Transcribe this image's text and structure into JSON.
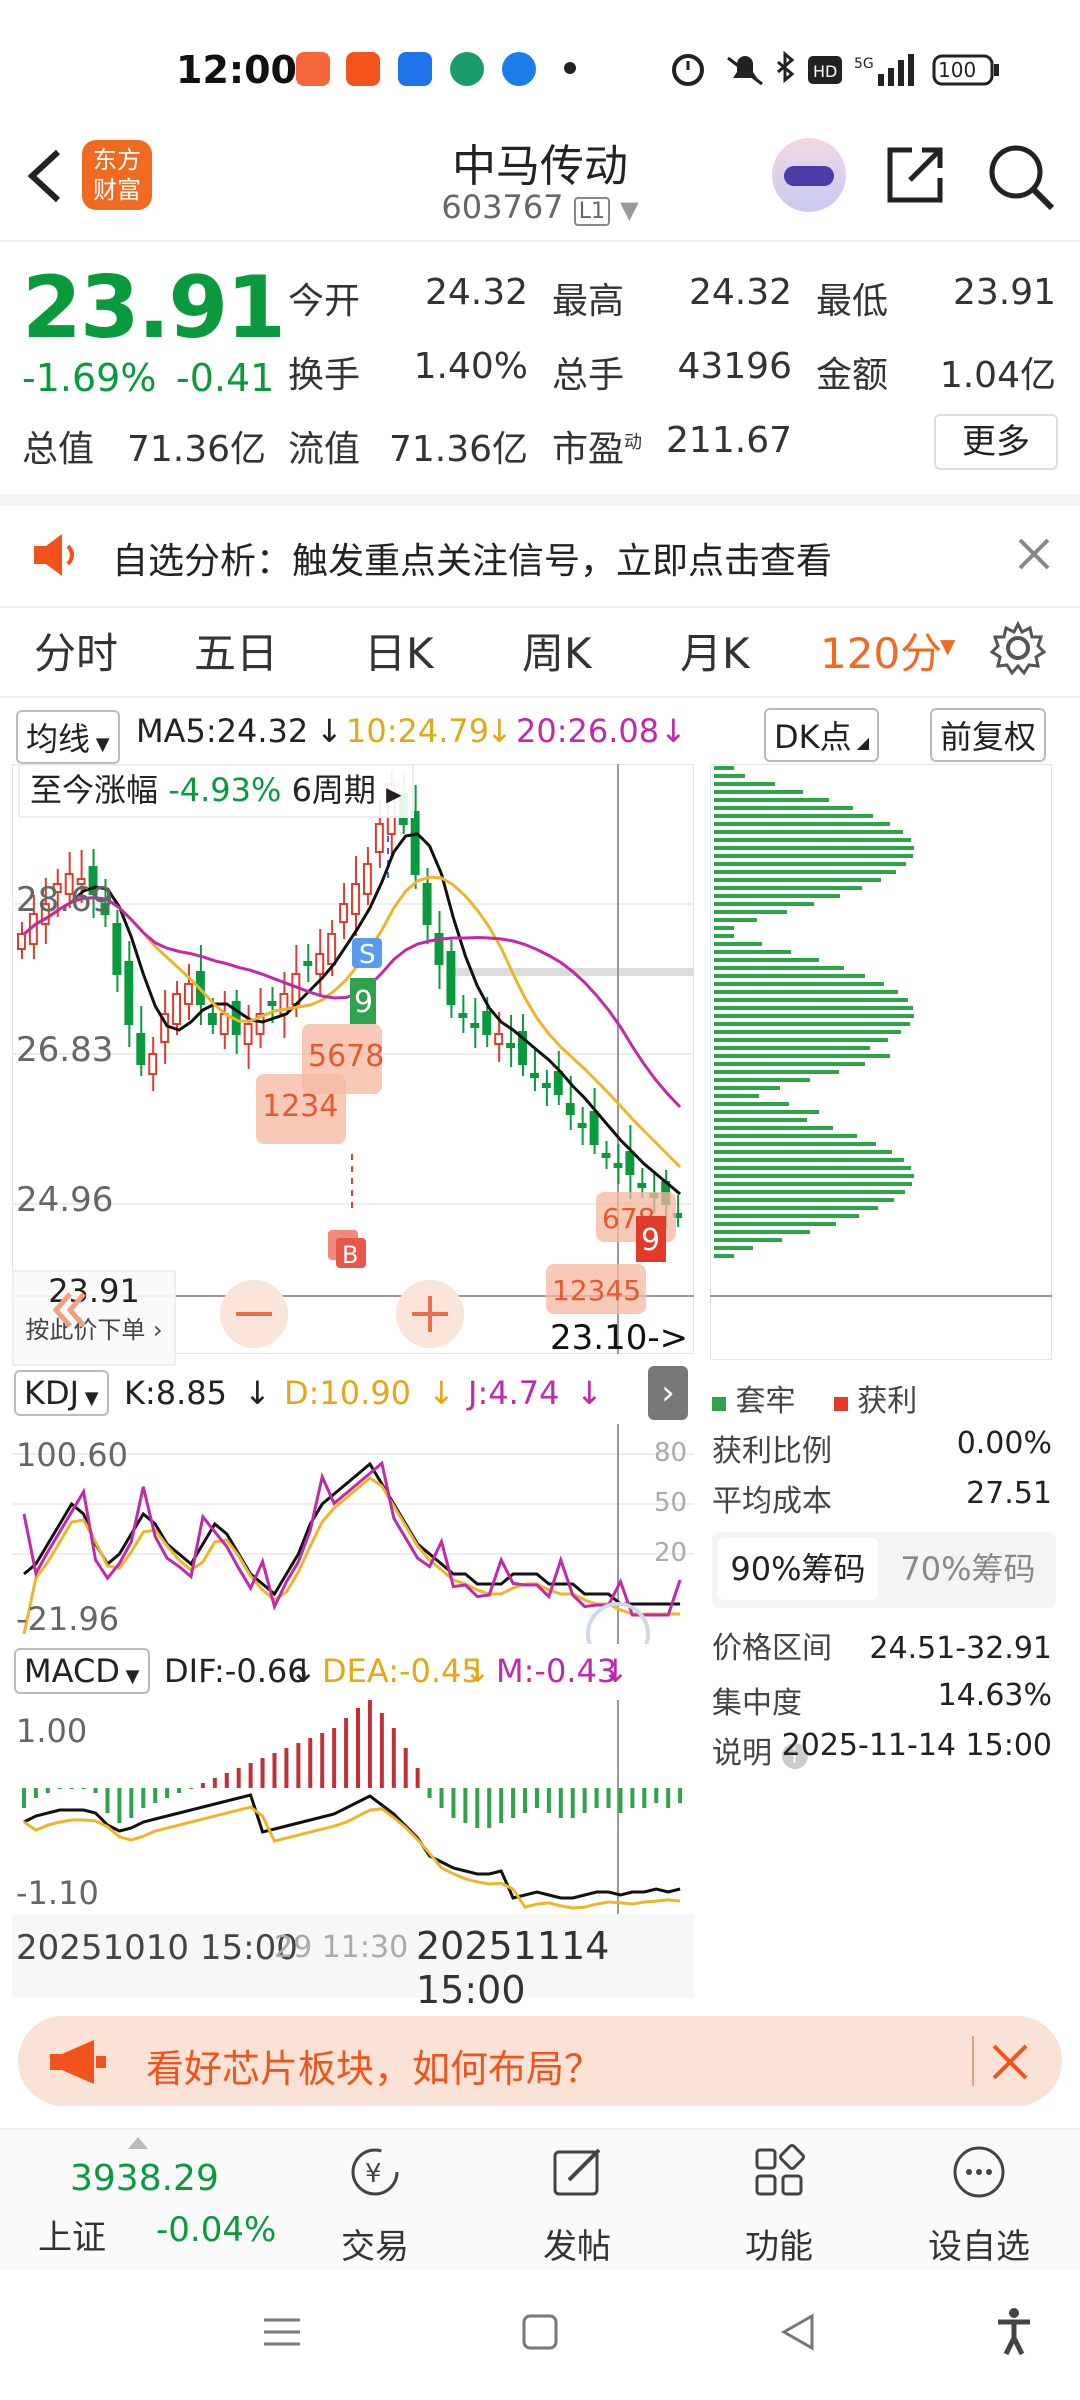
{
  "status": {
    "time": "12:00",
    "battery": "100"
  },
  "header": {
    "logo_text_1": "东方",
    "logo_text_2": "财富",
    "title": "中马传动",
    "code": "603767",
    "code_badge": "L1"
  },
  "quote": {
    "price": "23.91",
    "pct": "-1.69%",
    "chg": "-0.41",
    "open_label": "今开",
    "open": "24.32",
    "high_label": "最高",
    "high": "24.32",
    "low_label": "最低",
    "low": "23.91",
    "turnover_label": "换手",
    "turnover": "1.40%",
    "volume_label": "总手",
    "volume": "43196",
    "amount_label": "金额",
    "amount": "1.04亿",
    "mcap_label": "总值",
    "mcap": "71.36亿",
    "float_label": "流值",
    "float": "71.36亿",
    "pe_label": "市盈",
    "pe_sup": "动",
    "pe": "211.67",
    "more": "更多"
  },
  "notice": {
    "text": "自选分析：触发重点关注信号，立即点击查看"
  },
  "tabs": [
    "分时",
    "五日",
    "日K",
    "周K",
    "月K",
    "120分"
  ],
  "chart_toolbar": {
    "ma_select": "均线",
    "ma5": "MA5:24.32",
    "ma10": "10:24.79",
    "ma20": "20:26.08",
    "dk": "DK点",
    "adjust": "前复权",
    "change_label": "至今涨幅",
    "change_value": "-4.93%",
    "change_period": "6周期"
  },
  "price_axis": {
    "top": "28.69",
    "mid": "26.83",
    "low": "24.96"
  },
  "price_marker": {
    "price": "23.91",
    "label": "按此价下单",
    "arrow_text": "23.10->"
  },
  "kdj": {
    "name": "KDJ",
    "k": "K:8.85",
    "d": "D:10.90",
    "j": "J:4.74",
    "top": "100.60",
    "bottom": "-21.96",
    "lv80": "80",
    "lv50": "50",
    "lv20": "20"
  },
  "macd": {
    "name": "MACD",
    "dif": "DIF:-0.66",
    "dea": "DEA:-0.45",
    "m": "M:-0.43",
    "top": "1.00",
    "bottom": "-1.10"
  },
  "time_axis": {
    "left": "20251010 15:00",
    "mid": "29 11:30",
    "right": "20251114 15:00"
  },
  "chips": {
    "legend_trap": "套牢",
    "legend_profit": "获利",
    "profit_ratio_label": "获利比例",
    "profit_ratio": "0.00%",
    "avg_cost_label": "平均成本",
    "avg_cost": "27.51",
    "tab90": "90%筹码",
    "tab70": "70%筹码",
    "range_label": "价格区间",
    "range": "24.51-32.91",
    "conc_label": "集中度",
    "conc": "14.63%",
    "note_label": "说明",
    "note": "2025-11-14 15:00"
  },
  "chart_labels": {
    "s": "S",
    "b": "B",
    "nine_a": "9",
    "nine_b": "9",
    "seq_left": "1234",
    "seq_mid": "5678",
    "seq_right": "678",
    "seq_bottom": "12345"
  },
  "banner": {
    "text": "看好芯片板块，如何布局？"
  },
  "index": {
    "value": "3938.29",
    "name": "上证",
    "pct": "-0.04%"
  },
  "bottom_nav": [
    "交易",
    "发帖",
    "功能",
    "设自选"
  ]
}
